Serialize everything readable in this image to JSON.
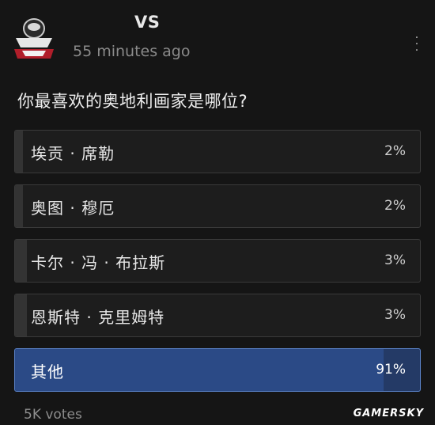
{
  "post": {
    "username": "VS",
    "timestamp": "55 minutes ago",
    "question": "你最喜欢的奥地利画家是哪位?"
  },
  "poll": {
    "options": [
      {
        "label": "埃贡 · 席勒",
        "percent": "2%",
        "value": 2
      },
      {
        "label": "奥图 · 穆厄",
        "percent": "2%",
        "value": 2
      },
      {
        "label": "卡尔 · 冯 · 布拉斯",
        "percent": "3%",
        "value": 3
      },
      {
        "label": "恩斯特 · 克里姆特",
        "percent": "3%",
        "value": 3
      },
      {
        "label": "其他",
        "percent": "91%",
        "value": 91,
        "selected": true
      }
    ],
    "votes": "5K votes"
  },
  "watermark": "GAMERSKY",
  "colors": {
    "background": "#151515",
    "selected_fill": "#2b4a86",
    "selected_border": "#5a82c8"
  }
}
